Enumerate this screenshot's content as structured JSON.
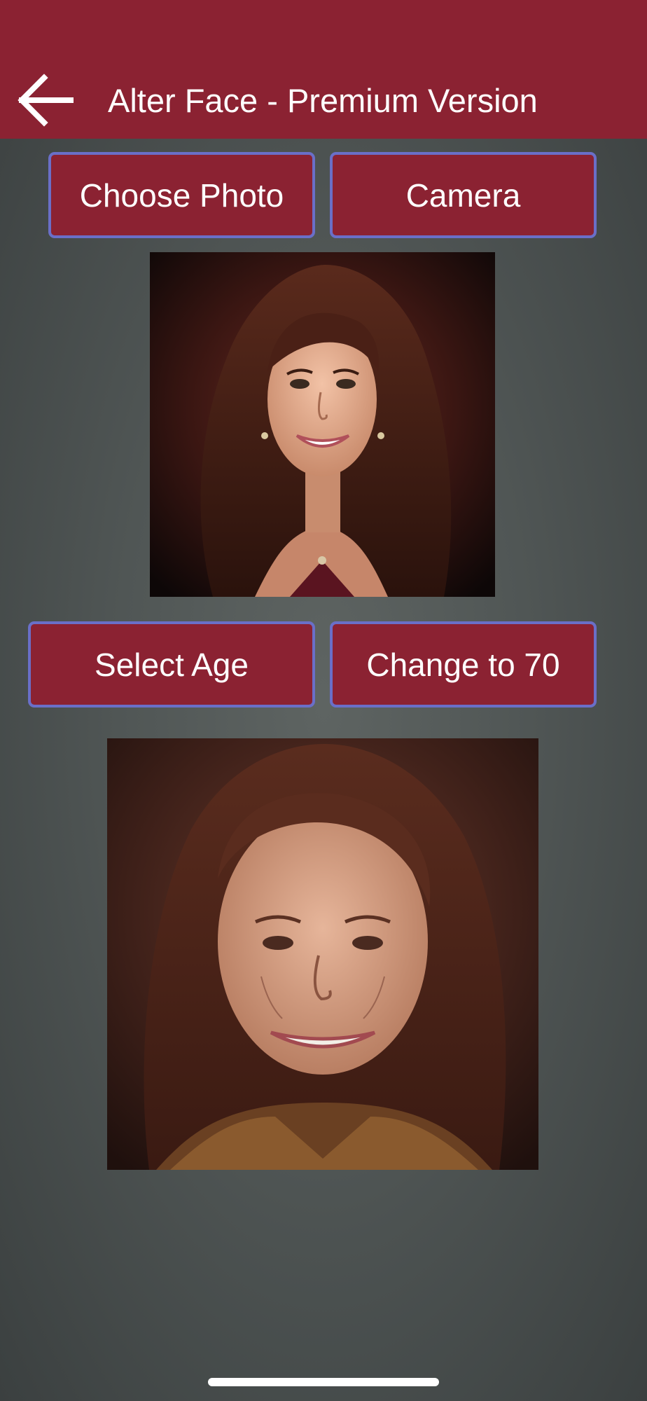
{
  "header": {
    "back_icon": "arrow-left-icon",
    "title": "Alter Face - Premium Version",
    "background_color": "#8b2232"
  },
  "actions_top": {
    "choose_photo_label": "Choose Photo",
    "camera_label": "Camera"
  },
  "images": {
    "original_alt": "Original portrait: smiling young woman with long brown hair",
    "aged_alt": "Aged portrait: same woman shown at age 70"
  },
  "actions_age": {
    "select_age_label": "Select Age",
    "change_label": "Change to 70"
  },
  "theme": {
    "button_color": "#8b2232",
    "button_border": "#6a6fc8",
    "text_color": "#ffffff"
  }
}
